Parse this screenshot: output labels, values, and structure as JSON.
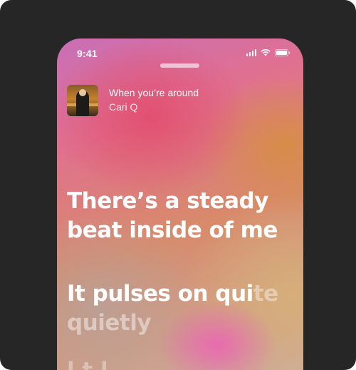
{
  "status_bar": {
    "time": "9:41",
    "icons": [
      "cellular-signal-icon",
      "wifi-icon",
      "battery-icon"
    ]
  },
  "now_playing": {
    "title": "When you’re around",
    "artist": "Cari Q"
  },
  "lyrics": {
    "line1": "There’s a steady",
    "line2": "beat inside of me",
    "line3_bright": "It pulses on qui",
    "line3_faded": "te",
    "line4": "quietly",
    "line5": "l  t      l"
  },
  "colors": {
    "frame_background": "#262626",
    "text": "#ffffff"
  }
}
